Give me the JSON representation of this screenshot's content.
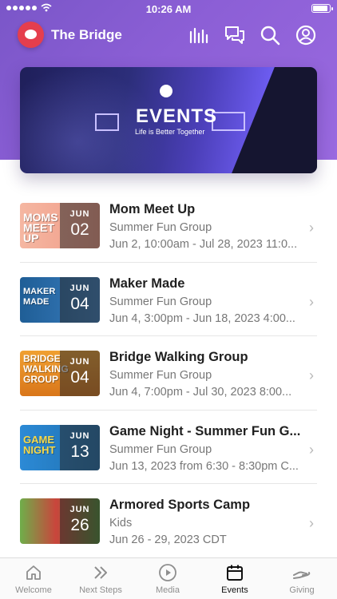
{
  "status_bar": {
    "time": "10:26 AM"
  },
  "header": {
    "title": "The Bridge"
  },
  "hero": {
    "title": "EVENTS",
    "subtitle": "Life is Better Together"
  },
  "events": [
    {
      "title": "Mom Meet Up",
      "group": "Summer Fun Group",
      "dates": "Jun 2, 10:00am - Jul 28, 2023 11:0...",
      "month": "JUN",
      "day": "02",
      "thumb_text": "MOMS MEET UP",
      "thumb_color": "#f2a58f"
    },
    {
      "title": "Maker Made",
      "group": "Summer Fun Group",
      "dates": "Jun 4, 3:00pm - Jun 18, 2023 4:00...",
      "month": "JUN",
      "day": "04",
      "thumb_text": "MAKER MADE",
      "thumb_color": "#2a6aa8"
    },
    {
      "title": "Bridge Walking Group",
      "group": "Summer Fun Group",
      "dates": "Jun 4, 7:00pm - Jul 30, 2023 8:00...",
      "month": "JUN",
      "day": "04",
      "thumb_text": "BRIDGE WALKING GROUP",
      "thumb_color": "#e2891f"
    },
    {
      "title": "Game Night - Summer Fun G...",
      "group": "Summer Fun Group",
      "dates": "Jun 13, 2023 from 6:30 - 8:30pm C...",
      "month": "JUN",
      "day": "13",
      "thumb_text": "GAME NIGHT",
      "thumb_color": "#2f86c9"
    },
    {
      "title": "Armored Sports Camp",
      "group": "Kids",
      "dates": "Jun 26 - 29, 2023 CDT",
      "month": "JUN",
      "day": "26",
      "thumb_text": "",
      "thumb_color": "#5a9e3b"
    }
  ],
  "tabs": [
    {
      "label": "Welcome",
      "icon": "home-icon"
    },
    {
      "label": "Next Steps",
      "icon": "double-chevron-icon"
    },
    {
      "label": "Media",
      "icon": "play-icon"
    },
    {
      "label": "Events",
      "icon": "calendar-icon"
    },
    {
      "label": "Giving",
      "icon": "giving-hand-icon"
    }
  ],
  "colors": {
    "header_purple": "#8c5fd6",
    "logo_red": "#e53e4d",
    "active_tab": "#111111",
    "inactive_tab": "#8e8e8e"
  }
}
